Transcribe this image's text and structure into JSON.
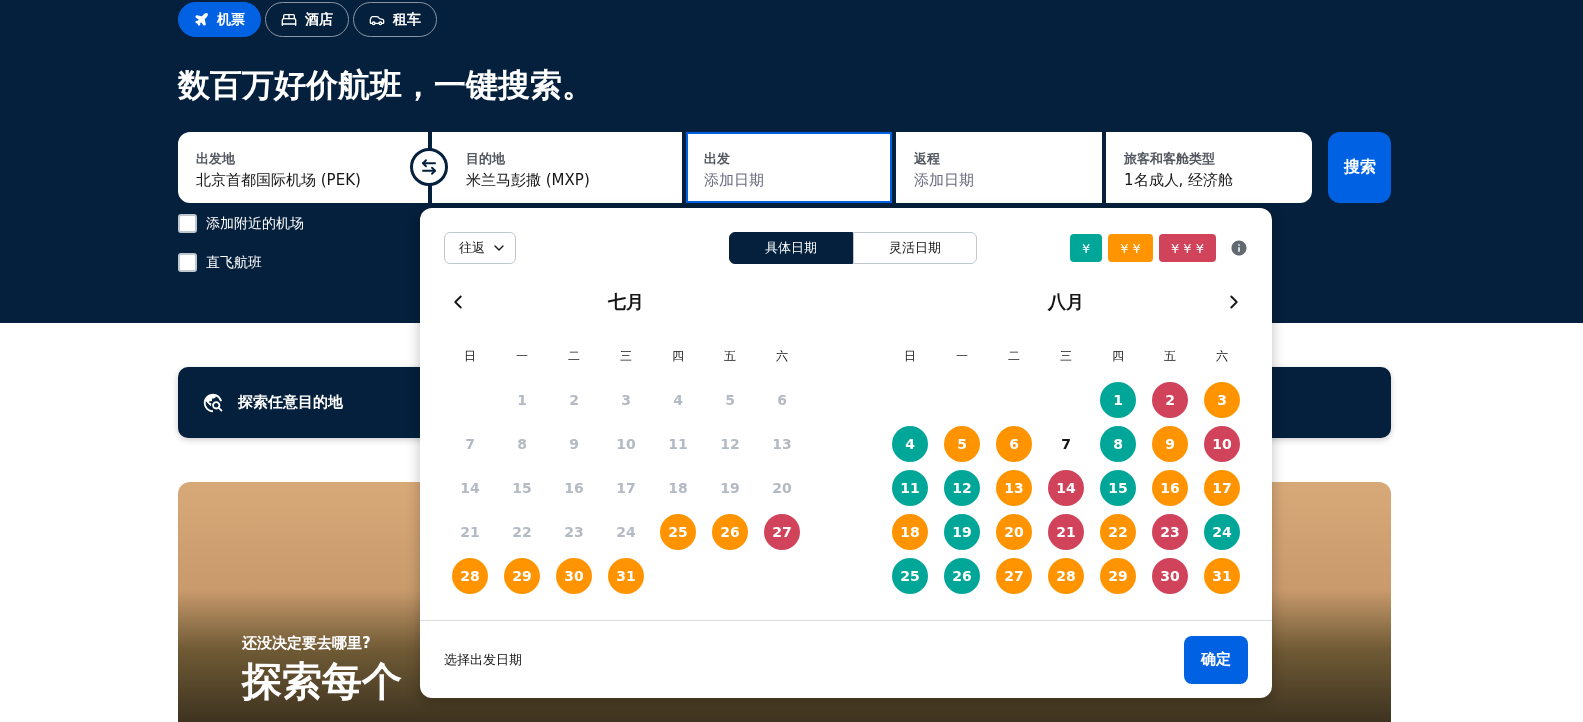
{
  "nav_tabs": [
    {
      "kind": "flights",
      "label": "机票",
      "selected": true
    },
    {
      "kind": "hotels",
      "label": "酒店",
      "selected": false
    },
    {
      "kind": "cars",
      "label": "租车",
      "selected": false
    }
  ],
  "headline": "数百万好价航班，一键搜索。",
  "search_fields": [
    {
      "label": "出发地",
      "value": "北京首都国际机场 (PEK)",
      "selected": false
    },
    {
      "label": "目的地",
      "value": "米兰马彭撒 (MXP)",
      "selected": false
    },
    {
      "label": "出发",
      "placeholder": "添加日期",
      "selected": true
    },
    {
      "label": "返程",
      "placeholder": "添加日期",
      "selected": false
    },
    {
      "label": "旅客和客舱类型",
      "value": "1名成人, 经济舱",
      "selected": false
    }
  ],
  "search_button": "搜索",
  "options": [
    {
      "label": "添加附近的机场",
      "checked": false
    },
    {
      "label": "直飞航班",
      "checked": false
    }
  ],
  "explore_bar": {
    "label": "探索任意目的地"
  },
  "hero": {
    "kicker": "还没决定要去哪里?",
    "title": "探索每个"
  },
  "date_picker": {
    "trip_type": "往返",
    "modes": [
      {
        "label": "具体日期",
        "selected": true
      },
      {
        "label": "灵活日期",
        "selected": false
      }
    ],
    "price_legend": [
      {
        "label": "¥",
        "color": "#00a698"
      },
      {
        "label": "¥ ¥",
        "color": "#ff9400"
      },
      {
        "label": "¥ ¥ ¥",
        "color": "#d1435b"
      }
    ],
    "months": [
      {
        "name": "七月",
        "weekdays": [
          "日",
          "一",
          "二",
          "三",
          "四",
          "五",
          "六"
        ],
        "days": [
          {
            "kind": "blank"
          },
          {
            "kind": "past",
            "day": "1"
          },
          {
            "kind": "past",
            "day": "2"
          },
          {
            "kind": "past",
            "day": "3"
          },
          {
            "kind": "past",
            "day": "4"
          },
          {
            "kind": "past",
            "day": "5"
          },
          {
            "kind": "past",
            "day": "6"
          },
          {
            "kind": "past",
            "day": "7"
          },
          {
            "kind": "past",
            "day": "8"
          },
          {
            "kind": "past",
            "day": "9"
          },
          {
            "kind": "past",
            "day": "10"
          },
          {
            "kind": "past",
            "day": "11"
          },
          {
            "kind": "past",
            "day": "12"
          },
          {
            "kind": "past",
            "day": "13"
          },
          {
            "kind": "past",
            "day": "14"
          },
          {
            "kind": "past",
            "day": "15"
          },
          {
            "kind": "past",
            "day": "16"
          },
          {
            "kind": "past",
            "day": "17"
          },
          {
            "kind": "past",
            "day": "18"
          },
          {
            "kind": "past",
            "day": "19"
          },
          {
            "kind": "past",
            "day": "20"
          },
          {
            "kind": "past",
            "day": "21"
          },
          {
            "kind": "past",
            "day": "22"
          },
          {
            "kind": "past",
            "day": "23"
          },
          {
            "kind": "past",
            "day": "24"
          },
          {
            "kind": "price",
            "day": "25",
            "color": "#ff9400"
          },
          {
            "kind": "price",
            "day": "26",
            "color": "#ff9400"
          },
          {
            "kind": "price",
            "day": "27",
            "color": "#d1435b"
          },
          {
            "kind": "price",
            "day": "28",
            "color": "#ff9400"
          },
          {
            "kind": "price",
            "day": "29",
            "color": "#ff9400"
          },
          {
            "kind": "price",
            "day": "30",
            "color": "#ff9400"
          },
          {
            "kind": "price",
            "day": "31",
            "color": "#ff9400"
          }
        ]
      },
      {
        "name": "八月",
        "weekdays": [
          "日",
          "一",
          "二",
          "三",
          "四",
          "五",
          "六"
        ],
        "days": [
          {
            "kind": "blank"
          },
          {
            "kind": "blank"
          },
          {
            "kind": "blank"
          },
          {
            "kind": "blank"
          },
          {
            "kind": "price",
            "day": "1",
            "color": "#00a698"
          },
          {
            "kind": "price",
            "day": "2",
            "color": "#d1435b"
          },
          {
            "kind": "price",
            "day": "3",
            "color": "#ff9400"
          },
          {
            "kind": "price",
            "day": "4",
            "color": "#00a698"
          },
          {
            "kind": "price",
            "day": "5",
            "color": "#ff9400"
          },
          {
            "kind": "price",
            "day": "6",
            "color": "#ff9400"
          },
          {
            "kind": "plain",
            "day": "7"
          },
          {
            "kind": "price",
            "day": "8",
            "color": "#00a698"
          },
          {
            "kind": "price",
            "day": "9",
            "color": "#ff9400"
          },
          {
            "kind": "price",
            "day": "10",
            "color": "#d1435b"
          },
          {
            "kind": "price",
            "day": "11",
            "color": "#00a698"
          },
          {
            "kind": "price",
            "day": "12",
            "color": "#00a698"
          },
          {
            "kind": "price",
            "day": "13",
            "color": "#ff9400"
          },
          {
            "kind": "price",
            "day": "14",
            "color": "#d1435b"
          },
          {
            "kind": "price",
            "day": "15",
            "color": "#00a698"
          },
          {
            "kind": "price",
            "day": "16",
            "color": "#ff9400"
          },
          {
            "kind": "price",
            "day": "17",
            "color": "#ff9400"
          },
          {
            "kind": "price",
            "day": "18",
            "color": "#ff9400"
          },
          {
            "kind": "price",
            "day": "19",
            "color": "#00a698"
          },
          {
            "kind": "price",
            "day": "20",
            "color": "#ff9400"
          },
          {
            "kind": "price",
            "day": "21",
            "color": "#d1435b"
          },
          {
            "kind": "price",
            "day": "22",
            "color": "#ff9400"
          },
          {
            "kind": "price",
            "day": "23",
            "color": "#d1435b"
          },
          {
            "kind": "price",
            "day": "24",
            "color": "#00a698"
          },
          {
            "kind": "price",
            "day": "25",
            "color": "#00a698"
          },
          {
            "kind": "price",
            "day": "26",
            "color": "#00a698"
          },
          {
            "kind": "price",
            "day": "27",
            "color": "#ff9400"
          },
          {
            "kind": "price",
            "day": "28",
            "color": "#ff9400"
          },
          {
            "kind": "price",
            "day": "29",
            "color": "#ff9400"
          },
          {
            "kind": "price",
            "day": "30",
            "color": "#d1435b"
          },
          {
            "kind": "price",
            "day": "31",
            "color": "#ff9400"
          }
        ]
      }
    ],
    "footer_hint": "选择出发日期",
    "confirm_button": "确定"
  }
}
